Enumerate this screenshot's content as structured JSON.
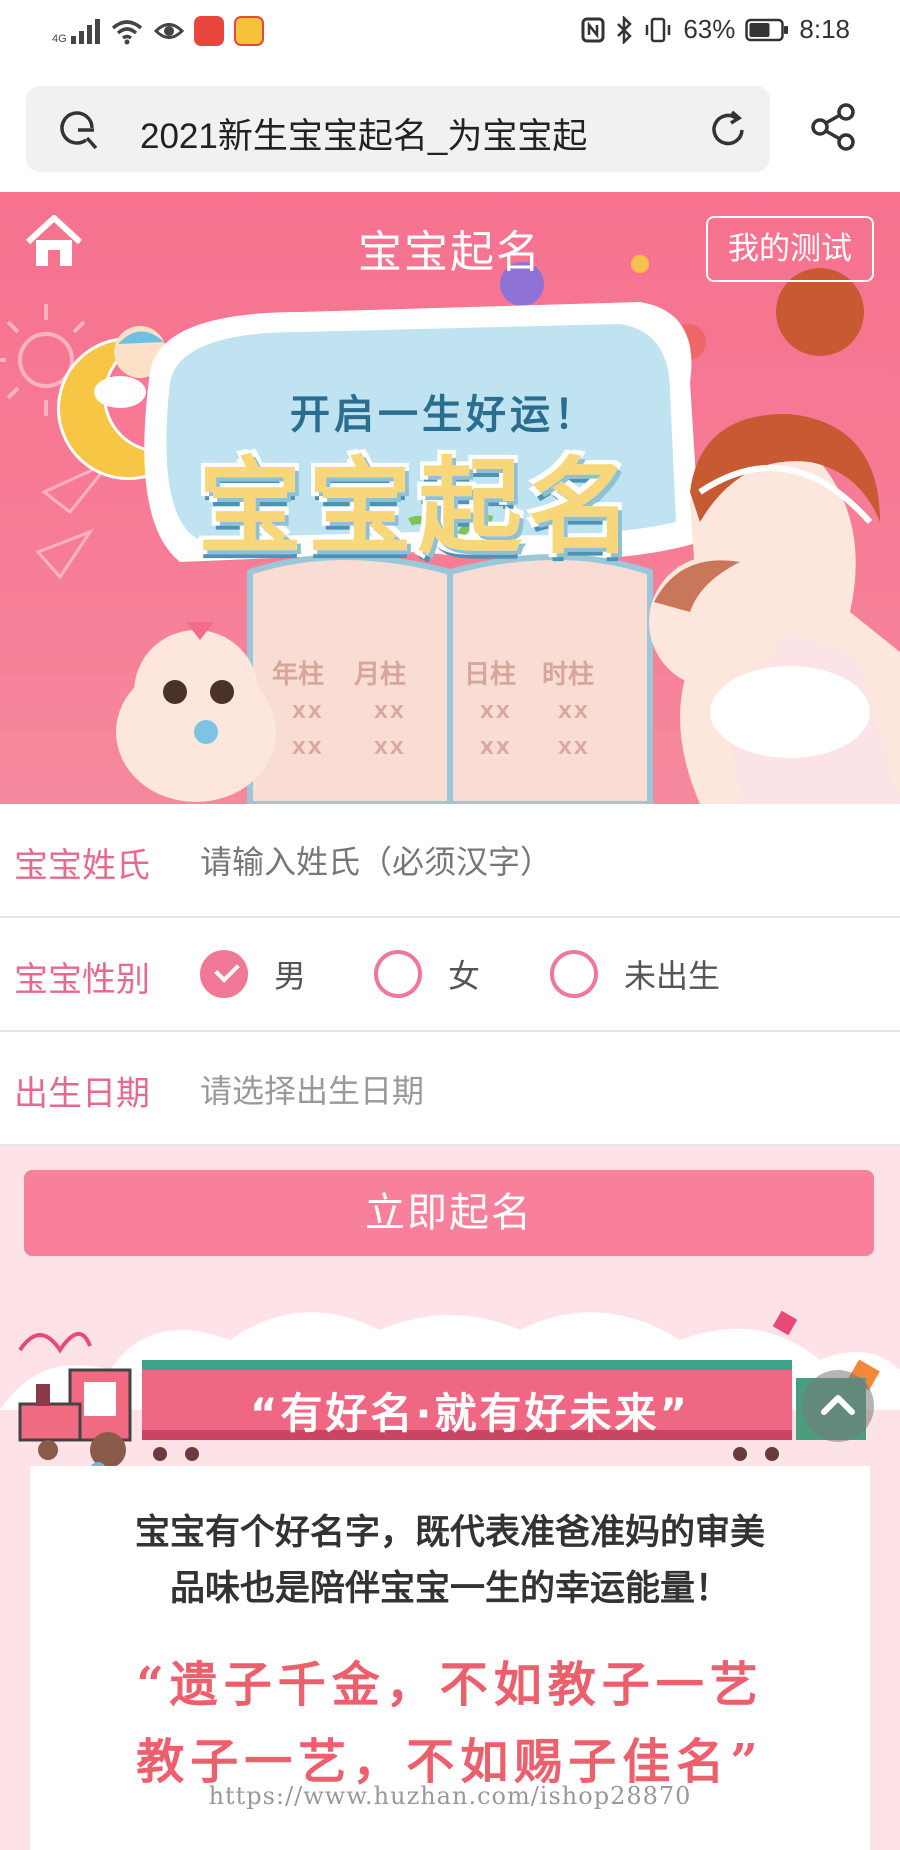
{
  "status": {
    "network": "4G",
    "battery_text": "63%",
    "time": "8:18"
  },
  "browser": {
    "url_text": "2021新生宝宝起名_为宝宝起"
  },
  "header": {
    "title": "宝宝起名",
    "my_test": "我的测试"
  },
  "banner": {
    "slogan": "开启一生好运！",
    "title": "宝宝起名",
    "pillars": [
      "年柱",
      "月柱",
      "日柱",
      "时柱"
    ],
    "placeholder_cell": "XX"
  },
  "form": {
    "surname": {
      "label": "宝宝姓氏",
      "placeholder": "请输入姓氏（必须汉字）"
    },
    "gender": {
      "label": "宝宝性别",
      "options": [
        "男",
        "女",
        "未出生"
      ],
      "selected": "男"
    },
    "birth": {
      "label": "出生日期",
      "placeholder": "请选择出生日期"
    },
    "submit": "立即起名"
  },
  "promo": {
    "banner_text": "“有好名·就有好未来”",
    "intro_line1": "宝宝有个好名字，既代表准爸准妈的审美",
    "intro_line2": "品味也是陪伴宝宝一生的幸运能量！",
    "quote_line1": "“遗子千金，不如教子一艺",
    "quote_line2": "教子一艺，不如赐子佳名”"
  },
  "watermark": "https://www.huzhan.com/ishop28870",
  "colors": {
    "brand_pink": "#f6728f",
    "label_pink": "#e66a8b",
    "button_pink": "#f8809a",
    "quote_red": "#ec5f6d",
    "page_bg_pink": "#fde3e8"
  }
}
